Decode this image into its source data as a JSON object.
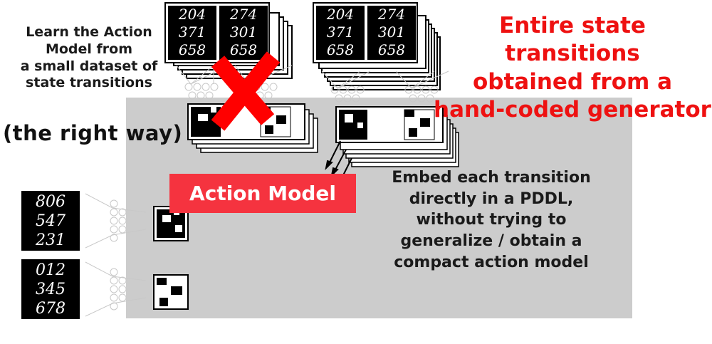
{
  "captions": {
    "left_lines": [
      "Learn the Action",
      "Model from",
      "a small dataset of",
      "state transitions"
    ],
    "right_way": "(the right way)",
    "red_lines": [
      "Entire state transitions",
      "obtained from a",
      "hand-coded generator"
    ],
    "embed_lines": [
      "Embed each transition",
      "directly in a PDDL,",
      "without trying to",
      "generalize / obtain a",
      "compact action model"
    ]
  },
  "action_model_label": "Action Model",
  "mnist_tiles": {
    "top_left_a": "204\n371\n658",
    "top_left_b": "274\n301\n658",
    "top_right_a": "204\n371\n658",
    "top_right_b": "274\n301\n658",
    "bottom_1": "806\n547\n231",
    "bottom_2": "012\n345\n678"
  },
  "colors": {
    "accent_red": "#ee1111",
    "action_model_fill": "#f5333f",
    "panel_gray": "#cccccc",
    "cross_red": "#ff0000"
  }
}
